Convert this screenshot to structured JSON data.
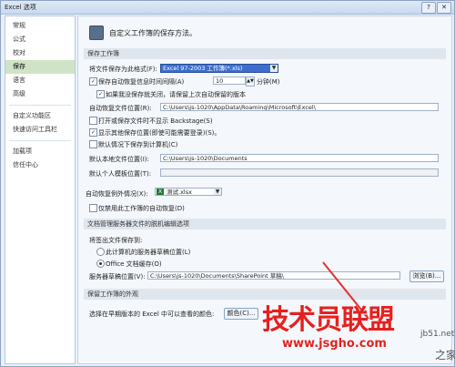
{
  "window": {
    "title": "Excel 选项",
    "help": "?",
    "close": "✕"
  },
  "sidebar": {
    "items": [
      {
        "label": "常规"
      },
      {
        "label": "公式"
      },
      {
        "label": "校对"
      },
      {
        "label": "保存",
        "active": true
      },
      {
        "label": "语言"
      },
      {
        "label": "高级"
      },
      {
        "label": "自定义功能区"
      },
      {
        "label": "快速访问工具栏"
      },
      {
        "label": "加载项"
      },
      {
        "label": "信任中心"
      }
    ]
  },
  "header": {
    "text": "自定义工作簿的保存方法。"
  },
  "save_workbooks": {
    "section_title": "保存工作簿",
    "format_label": "将文件保存为此格式(F):",
    "format_value": "Excel 97-2003 工作簿(*.xls)",
    "autorecover_label": "保存自动恢复信息时间间隔(A)",
    "autorecover_minutes": "10",
    "minutes_label": "分钟(M)",
    "keep_last_label": "如果我没保存就关闭，请保留上次自动保留的版本",
    "autorecover_location_label": "自动恢复文件位置(R):",
    "autorecover_location_value": "C:\\Users\\js-1020\\AppData\\Roaming\\Microsoft\\Excel\\",
    "backstage_label": "打开或保存文件时不显示 Backstage(S)",
    "show_more_label": "显示其他保存位置(即使可能需要登录)(S)。",
    "default_computer_label": "默认情况下保存到计算机(C)",
    "default_local_label": "默认本地文件位置(I):",
    "default_local_value": "C:\\Users\\js-1020\\Documents",
    "default_template_label": "默认个人模板位置(T):",
    "default_template_value": ""
  },
  "autorecover_exceptions": {
    "label": "自动恢复例外情况(X):",
    "workbook": "测试.xlsx",
    "disable_label": "仅禁用此工作簿的自动恢复(D)"
  },
  "offline_editing": {
    "section_title": "文档管理服务器文件的脱机编辑选项",
    "save_to_label": "将签出文件保存到:",
    "option_server": "此计算机的服务器草稿位置(L)",
    "option_cache": "Office 文档缓存(O)",
    "drafts_label": "服务器草稿位置(V):",
    "drafts_value": "C:\\Users\\js-1020\\Documents\\SharePoint 草稿\\",
    "browse_button": "浏览(B)..."
  },
  "preserve_appearance": {
    "section_title": "保留工作簿的外观",
    "colors_label": "选择在早期版本的 Excel 中可以查看的颜色:",
    "colors_button": "颜色(C)..."
  },
  "watermark": {
    "main": "技术员联盟",
    "url": "www.jsgho.com",
    "site1": "jb51.net",
    "site2": "之家"
  },
  "colors": {
    "accent": "#3b6ecf",
    "sidebar_active": "#cfe4c7",
    "arrow": "#e53030"
  }
}
